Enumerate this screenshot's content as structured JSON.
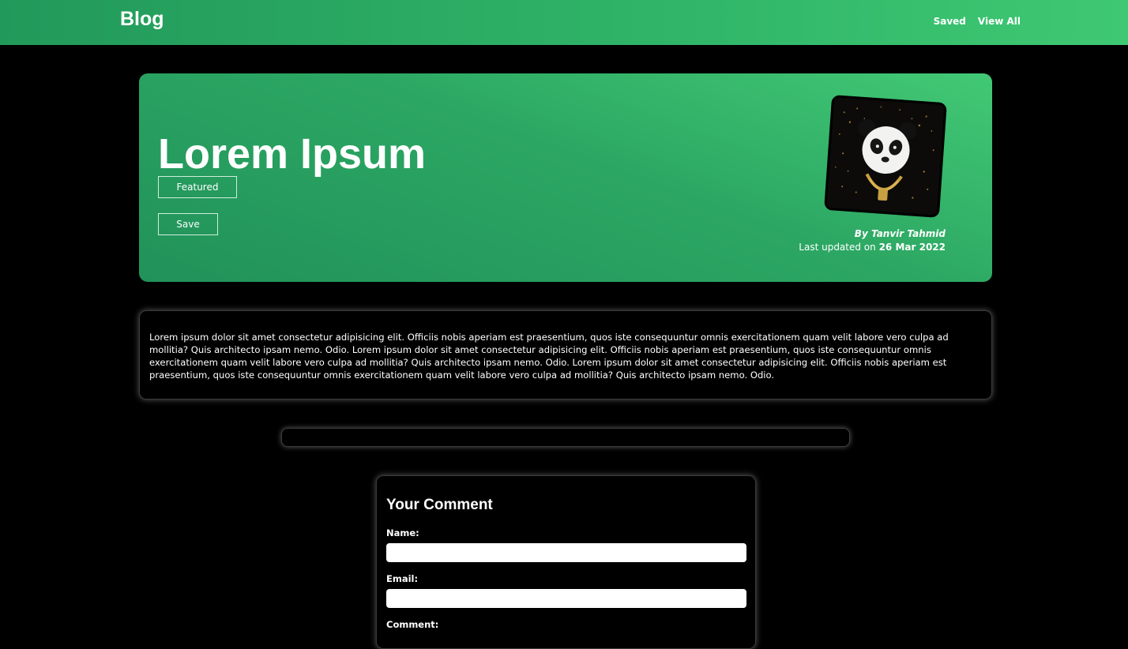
{
  "navbar": {
    "brand": "Blog",
    "links": [
      "Saved",
      "View All"
    ]
  },
  "hero": {
    "title": "Lorem Ipsum",
    "featured_label": "Featured",
    "save_label": "Save",
    "author": "By Tanvir Tahmid",
    "updated_prefix": "Last updated on ",
    "updated_date": "26 Mar 2022",
    "avatar_icon": "panda-avatar"
  },
  "content": {
    "text": "Lorem ipsum dolor sit amet consectetur adipisicing elit. Officiis nobis aperiam est praesentium, quos iste consequuntur omnis exercitationem quam velit labore vero culpa ad mollitia? Quis architecto ipsam nemo. Odio. Lorem ipsum dolor sit amet consectetur adipisicing elit. Officiis nobis aperiam est praesentium, quos iste consequuntur omnis exercitationem quam velit labore vero culpa ad mollitia? Quis architecto ipsam nemo. Odio. Lorem ipsum dolor sit amet consectetur adipisicing elit. Officiis nobis aperiam est praesentium, quos iste consequuntur omnis exercitationem quam velit labore vero culpa ad mollitia? Quis architecto ipsam nemo. Odio."
  },
  "comment_form": {
    "title": "Your Comment",
    "name_label": "Name:",
    "name_value": "",
    "email_label": "Email:",
    "email_value": "",
    "comment_label": "Comment:"
  },
  "colors": {
    "accent": "#2fb367",
    "background": "#000000"
  }
}
